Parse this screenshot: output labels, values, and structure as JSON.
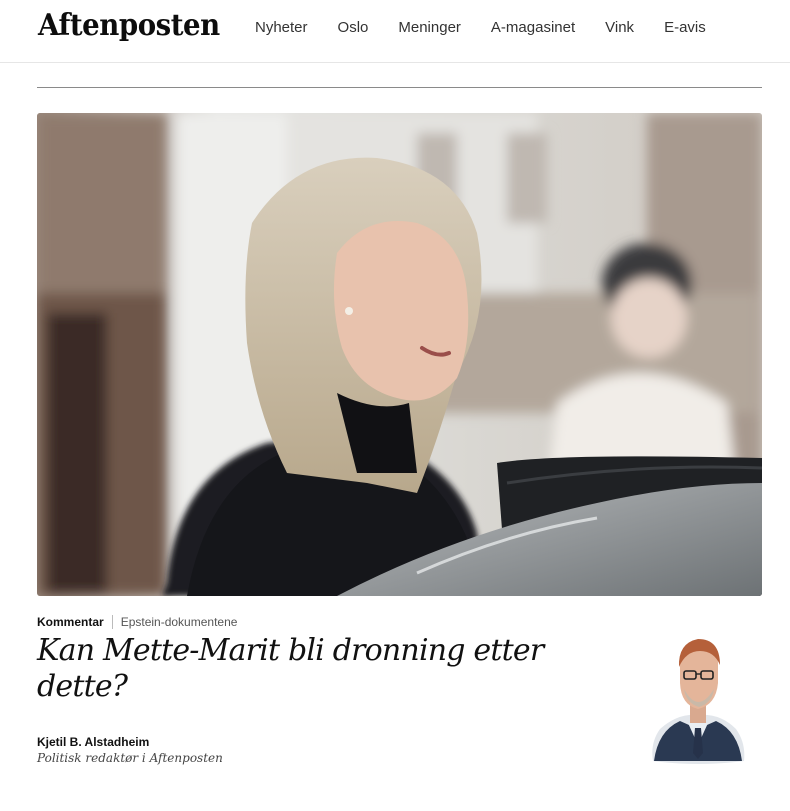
{
  "header": {
    "logo": "Aftenposten",
    "nav": [
      "Nyheter",
      "Oslo",
      "Meninger",
      "A-magasinet",
      "Vink",
      "E-avis"
    ]
  },
  "article": {
    "category": "Kommentar",
    "topic": "Epstein-dokumentene",
    "headline": "Kan Mette-Marit bli dronning etter dette?",
    "author": "Kjetil B. Alstadheim",
    "author_role": "Politisk redaktør i Aftenposten"
  },
  "colors": {
    "text": "#111111",
    "nav_text": "#333333",
    "rule": "#8a8a8a"
  }
}
